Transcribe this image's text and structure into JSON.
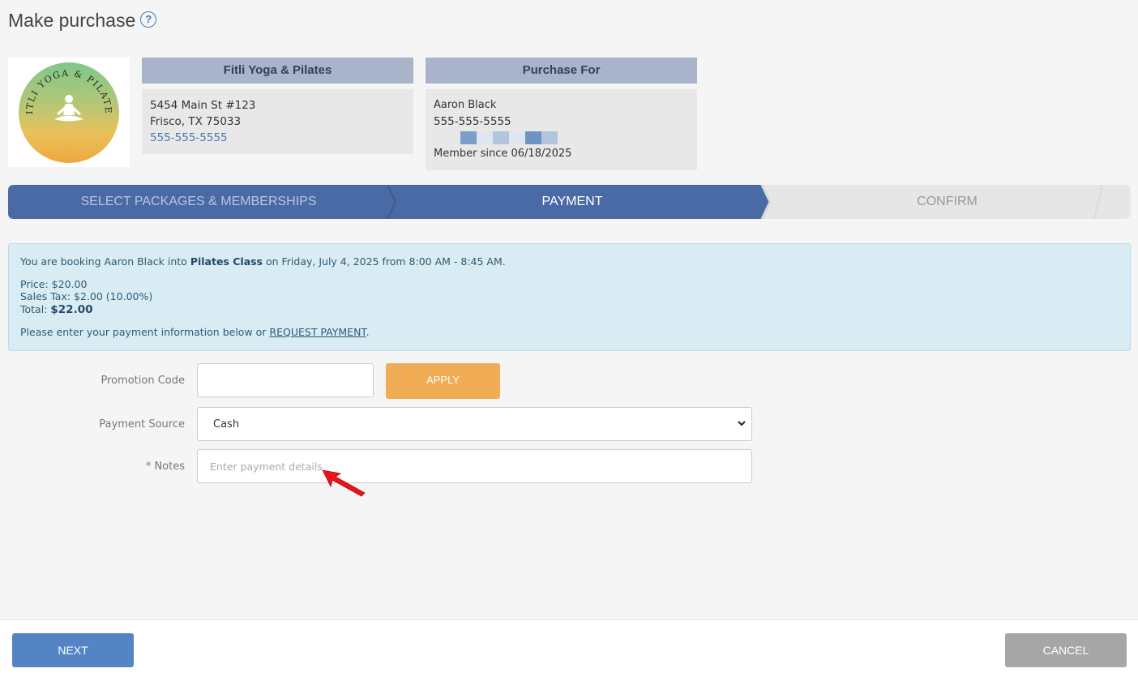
{
  "page": {
    "title": "Make purchase",
    "help_icon": "question-circle-icon"
  },
  "logo": {
    "text": "FITLI YOGA & PILATES"
  },
  "studio": {
    "header": "Fitli Yoga & Pilates",
    "address_line1": "5454 Main St #123",
    "address_line2": "Frisco, TX 75033",
    "phone": "555-555-5555"
  },
  "purchase_for": {
    "header": "Purchase For",
    "name": "Aaron Black",
    "phone": "555-555-5555",
    "member_since": "Member since 06/18/2025"
  },
  "steps": [
    {
      "label": "SELECT PACKAGES & MEMBERSHIPS",
      "state": "completed"
    },
    {
      "label": "PAYMENT",
      "state": "active"
    },
    {
      "label": "CONFIRM",
      "state": "upcoming"
    }
  ],
  "booking": {
    "intro": "You are booking Aaron Black into ",
    "class_name": "Pilates Class",
    "when": " on Friday, July 4, 2025 from 8:00 AM - 8:45 AM.",
    "price": "Price: $20.00",
    "tax": "Sales Tax: $2.00 (10.00%)",
    "total_label": "Total: ",
    "total_value": "$22.00",
    "payment_prompt": "Please enter your payment information below or ",
    "request_payment_link": "REQUEST PAYMENT",
    "period": "."
  },
  "form": {
    "promo_label": "Promotion Code",
    "promo_value": "",
    "apply_label": "APPLY",
    "source_label": "Payment Source",
    "source_value": "Cash",
    "notes_label": "* Notes",
    "notes_placeholder": "Enter payment details"
  },
  "footer": {
    "next_label": "NEXT",
    "cancel_label": "CANCEL"
  },
  "colors": {
    "step_active": "#4a6aa5",
    "step_upcoming": "#e6e6e6",
    "primary": "#5584c5",
    "apply": "#f0ad55",
    "cancel": "#a6a6a6",
    "alert_bg": "#d9ecf4",
    "annotation_arrow": "#e8141a"
  }
}
